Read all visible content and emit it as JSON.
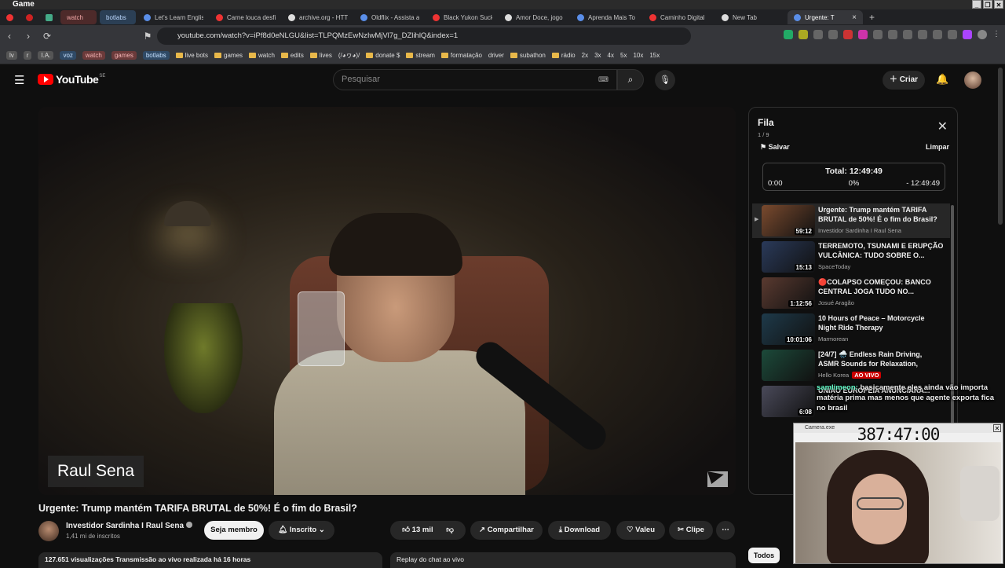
{
  "window": {
    "title": "Game"
  },
  "tabs": [
    {
      "label": "watch",
      "style": "group1"
    },
    {
      "label": "botlabs",
      "style": "group2"
    },
    {
      "label": "Let's Learn English",
      "style": ""
    },
    {
      "label": "Carne louca desfia",
      "style": ""
    },
    {
      "label": "archive.org - HTT",
      "style": ""
    },
    {
      "label": "Oldflix - Assista a",
      "style": ""
    },
    {
      "label": "Black Yukon Sucke",
      "style": ""
    },
    {
      "label": "Amor Doce, jogo",
      "style": ""
    },
    {
      "label": "Aprenda Mais To",
      "style": ""
    },
    {
      "label": "Caminho Digital",
      "style": ""
    },
    {
      "label": "New Tab",
      "style": ""
    },
    {
      "label": "Urgente: T",
      "style": "active"
    }
  ],
  "address": {
    "url": "youtube.com/watch?v=iPf8d0eNLGU&list=TLPQMzEwNzIwMjVl7g_DZlihlQ&index=1"
  },
  "bookmarks": [
    {
      "label": "lv",
      "kind": "chip"
    },
    {
      "label": "r",
      "kind": "chip"
    },
    {
      "label": "I.A.",
      "kind": "chip"
    },
    {
      "label": "voz",
      "kind": "chip blue"
    },
    {
      "label": "watch",
      "kind": "chip red"
    },
    {
      "label": "games",
      "kind": "chip red"
    },
    {
      "label": "botlabs",
      "kind": "chip blue"
    },
    {
      "label": "live bots",
      "kind": "folder"
    },
    {
      "label": "games",
      "kind": "folder"
    },
    {
      "label": "watch",
      "kind": "folder"
    },
    {
      "label": "edits",
      "kind": "folder"
    },
    {
      "label": "lives",
      "kind": "folder"
    },
    {
      "label": "(/◕ヮ◕)/",
      "kind": "plain"
    },
    {
      "label": "donate $",
      "kind": "folder"
    },
    {
      "label": "stream",
      "kind": "folder"
    },
    {
      "label": "formatação",
      "kind": "folder"
    },
    {
      "label": "driver",
      "kind": "plain"
    },
    {
      "label": "subathon",
      "kind": "folder"
    },
    {
      "label": "rádio",
      "kind": "folder"
    },
    {
      "label": "2x",
      "kind": "plain"
    },
    {
      "label": "3x",
      "kind": "plain"
    },
    {
      "label": "4x",
      "kind": "plain"
    },
    {
      "label": "5x",
      "kind": "plain"
    },
    {
      "label": "10x",
      "kind": "plain"
    },
    {
      "label": "15x",
      "kind": "plain"
    }
  ],
  "youtube": {
    "logo_text": "YouTube",
    "region": "SE",
    "search_placeholder": "Pesquisar",
    "create_label": "Criar"
  },
  "video": {
    "name_card": "Raul Sena",
    "title": "Urgente: Trump mantém TARIFA BRUTAL de 50%! É o fim do Brasil?",
    "channel": "Investidor Sardinha I Raul Sena",
    "subscribers": "1,41 mi de inscritos",
    "member_label": "Seja membro",
    "subscribed_label": "Inscrito",
    "likes": "13 mil",
    "share_label": "Compartilhar",
    "download_label": "Download",
    "thanks_label": "Valeu",
    "clip_label": "Clipe",
    "views_line": "127.651 visualizações  Transmissão ao vivo realizada há 16 horas",
    "replay_chat": "Replay do chat ao vivo"
  },
  "queue": {
    "title": "Fila",
    "position": "1 / 9",
    "save_label": "Salvar",
    "clear_label": "Limpar",
    "total_label": "Total: 12:49:49",
    "start_time": "0:00",
    "percent": "0%",
    "remaining": "- 12:49:49",
    "items": [
      {
        "title": "Urgente: Trump mantém TARIFA BRUTAL de 50%! É o fim do Brasil?",
        "channel": "Investidor Sardinha I Raul Sena",
        "duration": "59:12",
        "active": true,
        "thumb": "#7a4a2e"
      },
      {
        "title": "TERREMOTO, TSUNAMI E ERUPÇÃO VULCÂNICA: TUDO SOBRE O...",
        "channel": "SpaceToday",
        "duration": "15:13",
        "active": false,
        "thumb": "#2a3a5a"
      },
      {
        "title": "🔴COLAPSO COMEÇOU: BANCO CENTRAL JOGA TUDO NO...",
        "channel": "Josué Aragão",
        "duration": "1:12:56",
        "active": false,
        "thumb": "#5a3a30"
      },
      {
        "title": "10 Hours of Peace – Motorcycle Night Ride Therapy",
        "channel": "Marmorean",
        "duration": "10:01:06",
        "active": false,
        "thumb": "#1e3a4a"
      },
      {
        "title": "[24/7] 🌧️ Endless Rain Driving, ASMR Sounds for Relaxation, Sleeping,...",
        "channel": "Hello Korea",
        "duration": "",
        "live": "AO VIVO",
        "active": false,
        "thumb": "#1c4a3a"
      },
      {
        "title": "UNIÃO EUROPEIA ANUNCIARA...",
        "channel": "",
        "duration": "6:08",
        "active": false,
        "thumb": "#4a4a5a"
      }
    ],
    "filter_label": "Todos"
  },
  "chat_overlay": {
    "name": "samlimeon:",
    "message": "basicamente eles ainda vão importa matéria prima mas menos que agente exporta fica no brasil"
  },
  "camera": {
    "title": "Camera.exe",
    "timer": "387:47:00"
  }
}
